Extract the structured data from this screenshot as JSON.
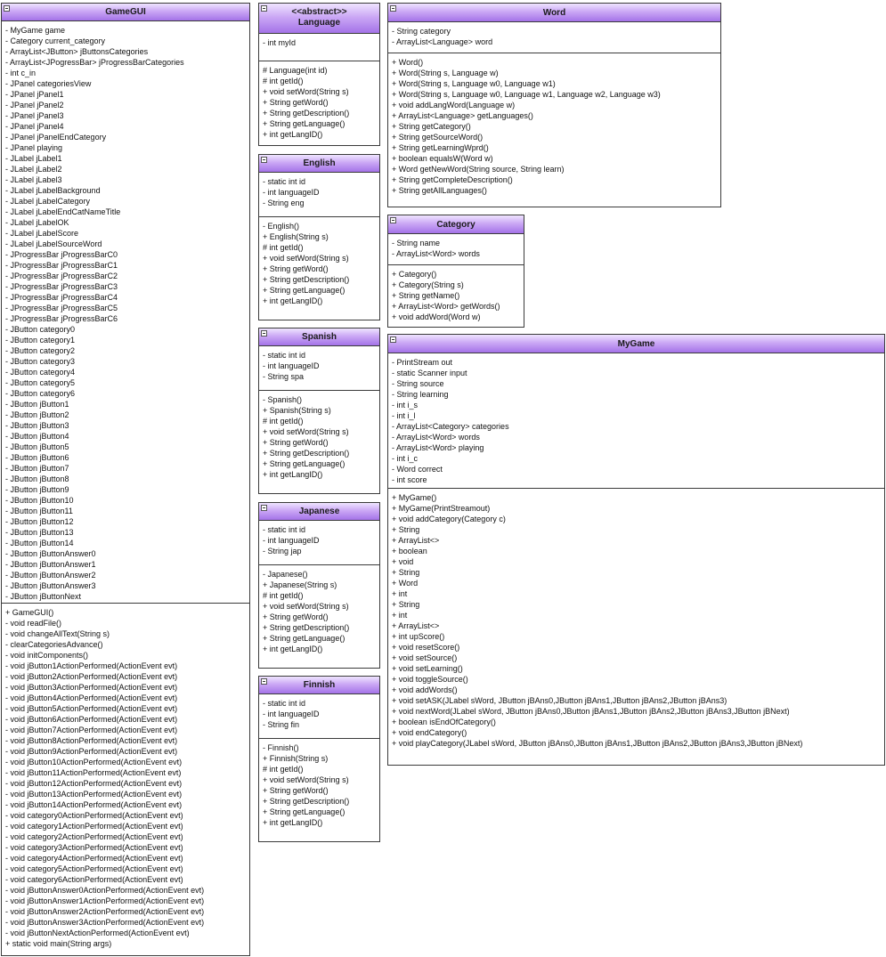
{
  "classes": {
    "gamegui": {
      "name": "GameGUI",
      "attributes": [
        "- MyGame game",
        "- Category current_category",
        "- ArrayList<JButton> jButtonsCategories",
        "- ArrayList<JPogressBar> jProgressBarCategories",
        "- int c_in",
        "- JPanel categoriesView",
        "- JPanel jPanel1",
        "- JPanel jPanel2",
        "- JPanel jPanel3",
        "- JPanel jPanel4",
        "- JPanel jPanelEndCategory",
        "- JPanel playing",
        "- JLabel jLabel1",
        "- JLabel jLabel2",
        "- JLabel jLabel3",
        "- JLabel jLabelBackground",
        "- JLabel jLabelCategory",
        "- JLabel jLabelEndCatNameTitle",
        "- JLabel jLabelOK",
        "- JLabel jLabelScore",
        "- JLabel jLabelSourceWord",
        "- JProgressBar jProgressBarC0",
        "- JProgressBar jProgressBarC1",
        "- JProgressBar jProgressBarC2",
        "- JProgressBar jProgressBarC3",
        "- JProgressBar jProgressBarC4",
        "- JProgressBar jProgressBarC5",
        "- JProgressBar jProgressBarC6",
        "- JButton category0",
        "- JButton category1",
        "- JButton category2",
        "- JButton category3",
        "- JButton category4",
        "- JButton category5",
        "- JButton category6",
        "- JButton jButton1",
        "- JButton jButton2",
        "- JButton jButton3",
        "- JButton jButton4",
        "- JButton jButton5",
        "- JButton jButton6",
        "- JButton jButton7",
        "- JButton jButton8",
        "- JButton jButton9",
        "- JButton jButton10",
        "- JButton jButton11",
        "- JButton jButton12",
        "- JButton jButton13",
        "- JButton jButton14",
        "- JButton jButtonAnswer0",
        "- JButton jButtonAnswer1",
        "- JButton jButtonAnswer2",
        "- JButton jButtonAnswer3",
        "- JButton jButtonNext"
      ],
      "methods": [
        "+ GameGUI()",
        "- void readFile()",
        "- void changeAllText(String s)",
        "- clearCategoriesAdvance()",
        "- void initComponents()",
        "- void jButton1ActionPerformed(ActionEvent evt)",
        "- void jButton2ActionPerformed(ActionEvent evt)",
        "- void jButton3ActionPerformed(ActionEvent evt)",
        "- void jButton4ActionPerformed(ActionEvent evt)",
        "- void jButton5ActionPerformed(ActionEvent evt)",
        "- void jButton6ActionPerformed(ActionEvent evt)",
        "- void jButton7ActionPerformed(ActionEvent evt)",
        "- void jButton8ActionPerformed(ActionEvent evt)",
        "- void jButton9ActionPerformed(ActionEvent evt)",
        "- void jButton10ActionPerformed(ActionEvent evt)",
        "- void jButton11ActionPerformed(ActionEvent evt)",
        "- void jButton12ActionPerformed(ActionEvent evt)",
        "- void jButton13ActionPerformed(ActionEvent evt)",
        "- void jButton14ActionPerformed(ActionEvent evt)",
        "- void category0ActionPerformed(ActionEvent evt)",
        "- void category1ActionPerformed(ActionEvent evt)",
        "- void category2ActionPerformed(ActionEvent evt)",
        "- void category3ActionPerformed(ActionEvent evt)",
        "- void category4ActionPerformed(ActionEvent evt)",
        "- void category5ActionPerformed(ActionEvent evt)",
        "- void category6ActionPerformed(ActionEvent evt)",
        "- void jButtonAnswer0ActionPerformed(ActionEvent evt)",
        "- void jButtonAnswer1ActionPerformed(ActionEvent evt)",
        "- void jButtonAnswer2ActionPerformed(ActionEvent evt)",
        "- void jButtonAnswer3ActionPerformed(ActionEvent evt)",
        "- void jButtonNextActionPerformed(ActionEvent evt)",
        "+ static void main(String args)"
      ]
    },
    "language": {
      "stereotype": "<<abstract>>",
      "name": "Language",
      "attributes": [
        "- int myId"
      ],
      "methods": [
        "# Language(int id)",
        "# int getId()",
        "+ void setWord(String s)",
        "+ String getWord()",
        "+ String getDescription()",
        "+ String getLanguage()",
        "+ int getLangID()"
      ]
    },
    "english": {
      "name": "English",
      "attributes": [
        "- static int id",
        "- int languageID",
        "- String eng"
      ],
      "methods": [
        "- English()",
        "+ English(String s)",
        "# int getId()",
        "+ void setWord(String s)",
        "+ String getWord()",
        "+ String getDescription()",
        "+ String getLanguage()",
        "+ int getLangID()"
      ]
    },
    "spanish": {
      "name": "Spanish",
      "attributes": [
        "- static int id",
        "- int languageID",
        "- String spa"
      ],
      "methods": [
        "- Spanish()",
        "+ Spanish(String s)",
        "# int getId()",
        "+ void setWord(String s)",
        "+ String getWord()",
        "+ String getDescription()",
        "+ String getLanguage()",
        "+ int getLangID()"
      ]
    },
    "japanese": {
      "name": "Japanese",
      "attributes": [
        "- static int id",
        "- int languageID",
        "- String jap"
      ],
      "methods": [
        "- Japanese()",
        "+ Japanese(String s)",
        "# int getId()",
        "+ void setWord(String s)",
        "+ String getWord()",
        "+ String getDescription()",
        "+ String getLanguage()",
        "+ int getLangID()"
      ]
    },
    "finnish": {
      "name": "Finnish",
      "attributes": [
        "- static int id",
        "- int languageID",
        "- String fin"
      ],
      "methods": [
        "- Finnish()",
        "+ Finnish(String s)",
        "# int getId()",
        "+ void setWord(String s)",
        "+ String getWord()",
        "+ String getDescription()",
        "+ String getLanguage()",
        "+ int getLangID()"
      ]
    },
    "word": {
      "name": "Word",
      "attributes": [
        "- String category",
        "- ArrayList<Language> word"
      ],
      "methods": [
        "+ Word()",
        "+ Word(String s, Language w)",
        "+ Word(String s, Language w0, Language w1)",
        "+ Word(String s, Language w0, Language w1, Language w2, Language w3)",
        "+ void addLangWord(Language w)",
        "+ ArrayList<Language> getLanguages()",
        "+ String getCategory()",
        "+ String getSourceWord()",
        "+ String getLearningWprd()",
        "+ boolean equalsW(Word w)",
        "+ Word getNewWord(String source, String learn)",
        "+ String getCompleteDescription()",
        "+ String getAllLanguages()"
      ]
    },
    "category": {
      "name": "Category",
      "attributes": [
        "- String name",
        "- ArrayList<Word> words"
      ],
      "methods": [
        "+ Category()",
        "+ Category(String s)",
        "+ String getName()",
        "+ ArrayList<Word> getWords()",
        "+ void addWord(Word w)"
      ]
    },
    "mygame": {
      "name": "MyGame",
      "attributes": [
        "- PrintStream out",
        "- static Scanner input",
        "- String source",
        "- String learning",
        "- int i_s",
        "- int i_l",
        "- ArrayList<Category> categories",
        "- ArrayList<Word> words",
        "- ArrayList<Word> playing",
        "- int i_c",
        "- Word correct",
        "- int score"
      ],
      "methods": [
        "+ MyGame()",
        "+ MyGame(PrintStreamout)",
        "+ void addCategory(Category c)",
        "+ String",
        "+ ArrayList<>",
        "+ boolean",
        "+ void",
        "+ String",
        "+ Word",
        "+ int",
        "+ String",
        "+ int",
        "+ ArrayList<>",
        "+ int upScore()",
        "+ void resetScore()",
        "+ void setSource()",
        "+ void setLearning()",
        "+ void toggleSource()",
        "+ void addWords()",
        "+ void setASK(JLabel sWord, JButton jBAns0,JButton jBAns1,JButton jBAns2,JButton jBAns3)",
        "+ void nextWord(JLabel sWord, JButton jBAns0,JButton jBAns1,JButton jBAns2,JButton jBAns3,JButton jBNext)",
        "+ boolean isEndOfCategory()",
        "+ void endCategory()",
        "+ void playCategory(JLabel sWord, JButton jBAns0,JButton jBAns1,JButton jBAns2,JButton jBAns3,JButton jBNext)"
      ]
    }
  }
}
